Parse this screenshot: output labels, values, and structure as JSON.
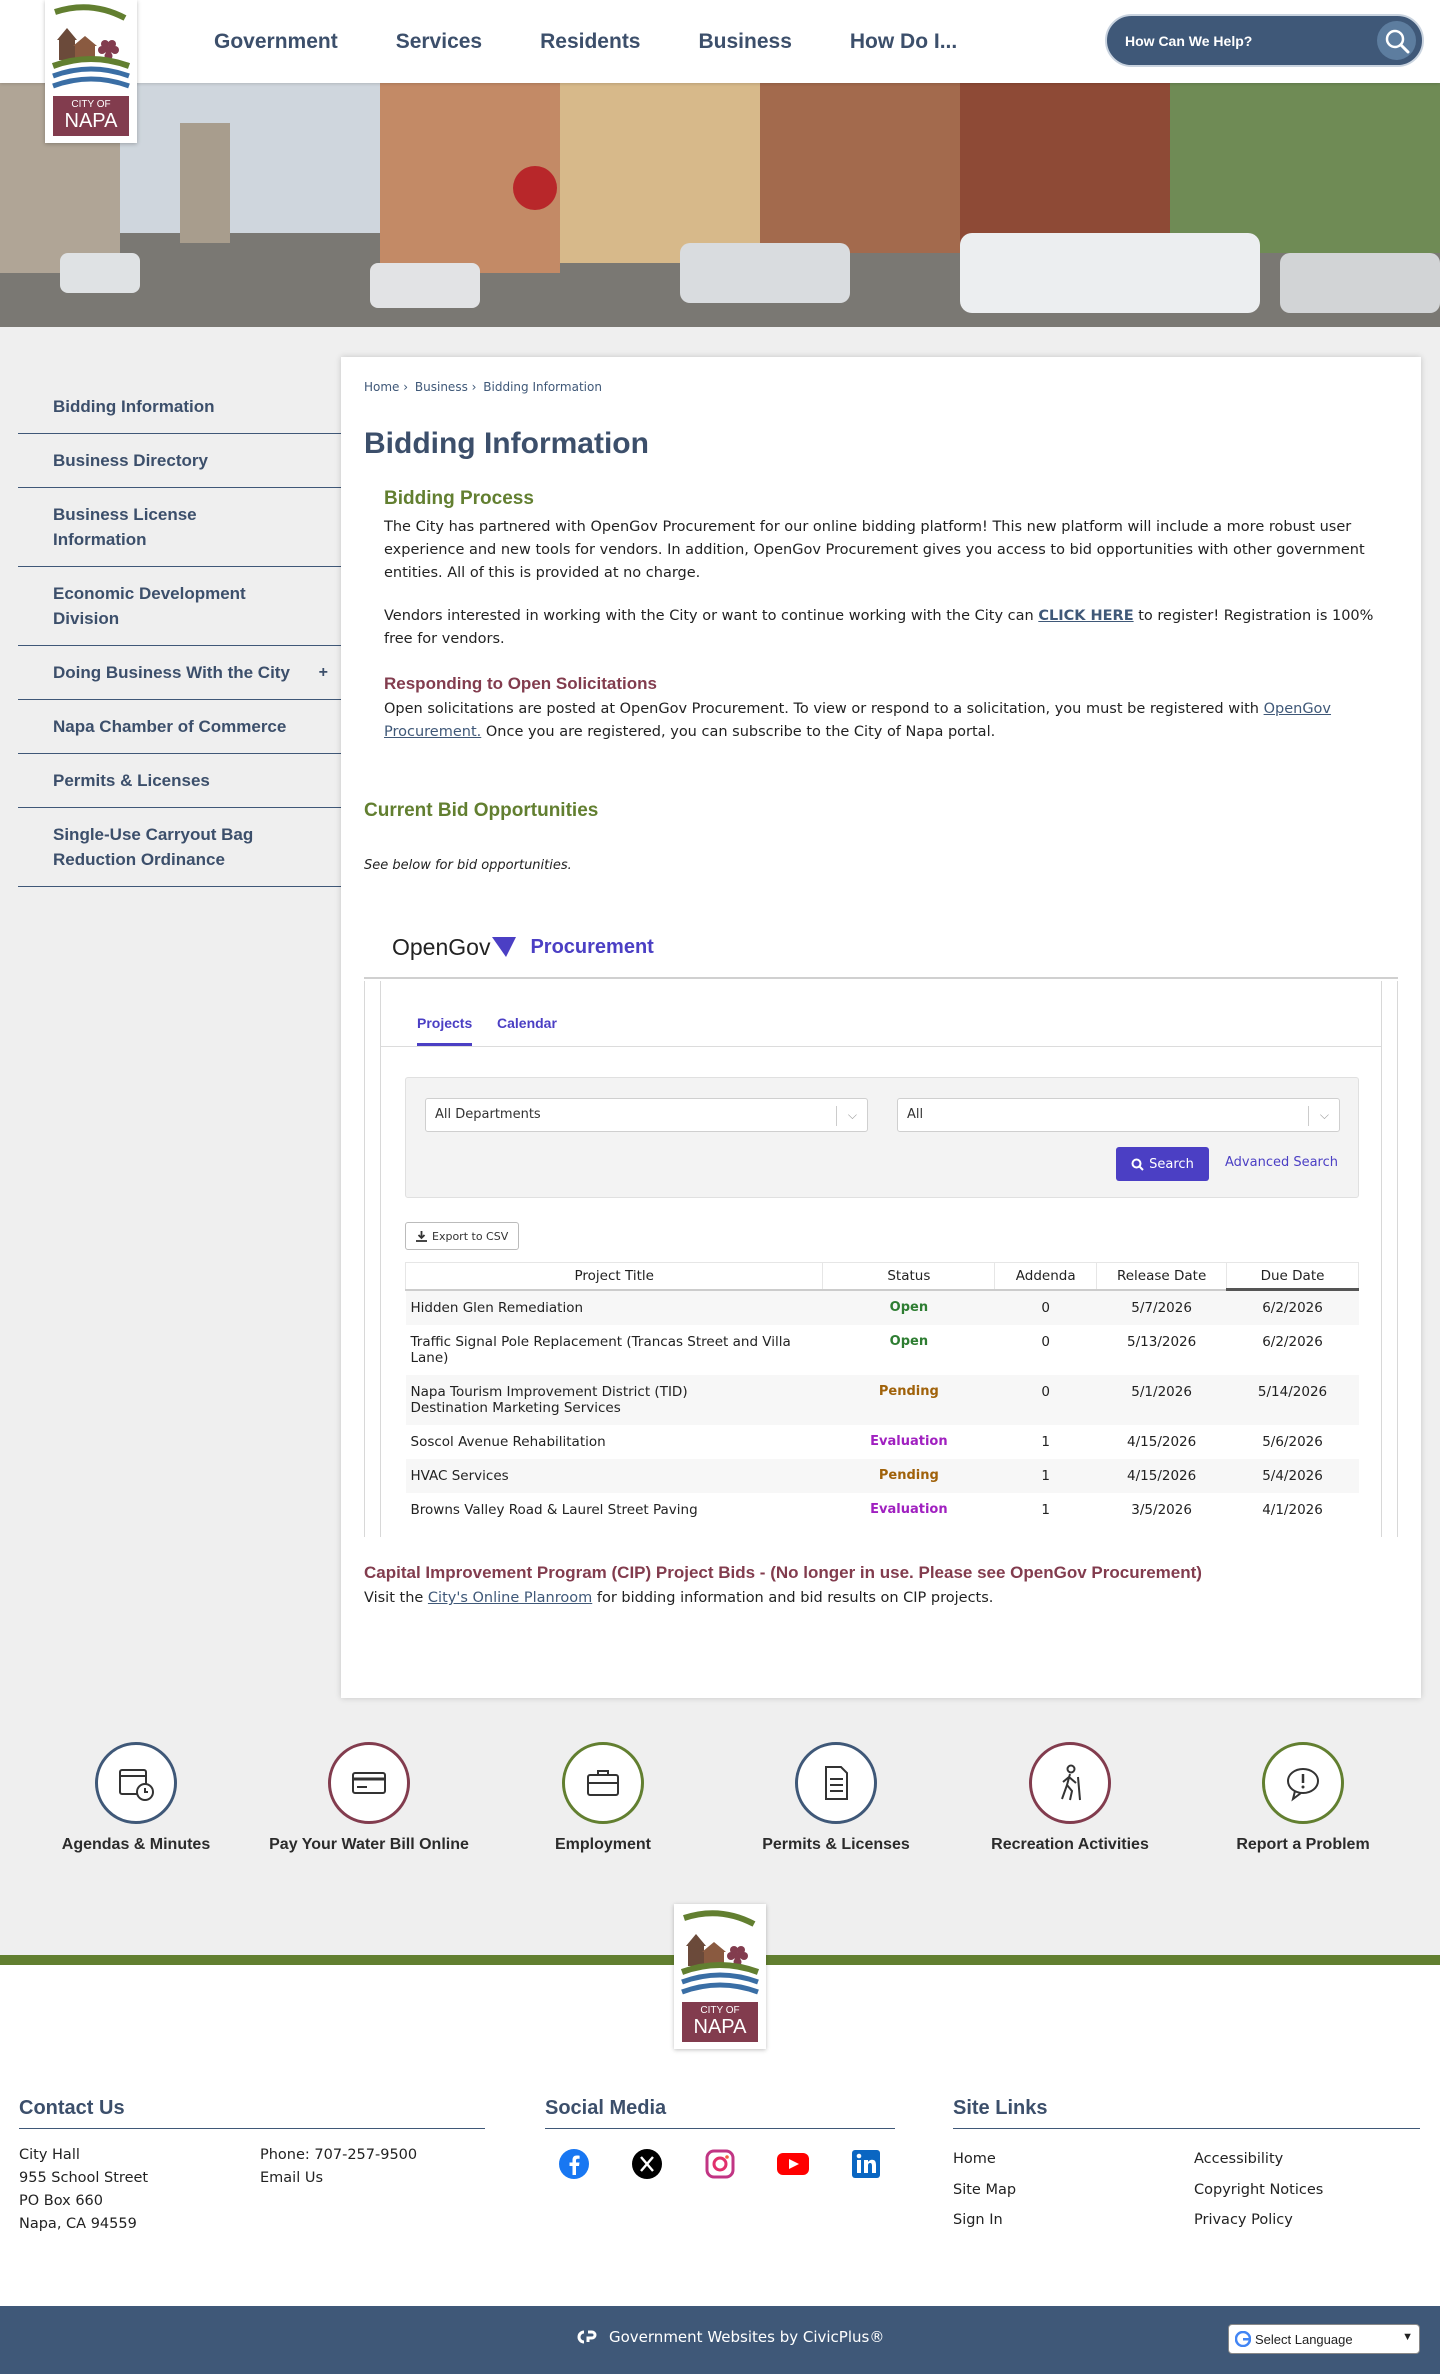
{
  "header": {
    "nav": [
      "Government",
      "Services",
      "Residents",
      "Business",
      "How Do I..."
    ],
    "search_placeholder": "How Can We Help?",
    "logo_text_1": "CITY OF",
    "logo_text_2": "NAPA"
  },
  "sidebar": {
    "items": [
      {
        "label": "Bidding Information"
      },
      {
        "label": "Business Directory"
      },
      {
        "label": "Business License Information"
      },
      {
        "label": "Economic Development Division"
      },
      {
        "label": "Doing Business With the City",
        "expand": "+"
      },
      {
        "label": "Napa Chamber of Commerce"
      },
      {
        "label": "Permits & Licenses"
      },
      {
        "label": "Single-Use Carryout Bag Reduction Ordinance"
      }
    ]
  },
  "breadcrumb": [
    "Home",
    "›",
    "Business",
    "›",
    "Bidding Information"
  ],
  "page_title": "Bidding Information",
  "bidding_process": {
    "heading": "Bidding Process",
    "para1": "The City has partnered with OpenGov Procurement for our online bidding platform! This new platform will include a more robust user experience and new tools for vendors. In addition, OpenGov Procurement gives you access to bid opportunities with other government entities. All of this is provided at no charge.",
    "para2_before": "Vendors interested in working with the City or want to continue working with the City can ",
    "para2_link": "CLICK HERE",
    "para2_after": " to register! Registration is 100% free for vendors."
  },
  "solicitations": {
    "heading": "Responding to Open Solicitations",
    "text_before": "Open solicitations are posted at OpenGov Procurement.  To view or respond to a solicitation, you must be registered with ",
    "link": "OpenGov Procurement.",
    "text_after": " Once you are registered, you can subscribe to the City of Napa portal."
  },
  "current_bids": {
    "heading": "Current Bid Opportunities",
    "note": "See below for bid opportunities."
  },
  "opengov": {
    "brand": "OpenGov",
    "product": "Procurement",
    "tabs": [
      "Projects",
      "Calendar"
    ],
    "department_select": "All Departments",
    "status_select": "All",
    "search_button": "Search",
    "advanced_search": "Advanced Search",
    "export_button": "Export to CSV",
    "columns": [
      "Project Title",
      "Status",
      "Addenda",
      "Release Date",
      "Due Date"
    ],
    "rows": [
      {
        "title": "Hidden Glen Remediation",
        "status": "Open",
        "addenda": "0",
        "release": "5/7/2026",
        "due": "6/2/2026"
      },
      {
        "title": "Traffic Signal Pole Replacement (Trancas Street and Villa Lane)",
        "status": "Open",
        "addenda": "0",
        "release": "5/13/2026",
        "due": "6/2/2026"
      },
      {
        "title": "Napa Tourism Improvement District (TID) Destination Marketing Services",
        "status": "Pending",
        "addenda": "0",
        "release": "5/1/2026",
        "due": "5/14/2026"
      },
      {
        "title": "Soscol Avenue Rehabilitation",
        "status": "Evaluation",
        "addenda": "1",
        "release": "4/15/2026",
        "due": "5/6/2026"
      },
      {
        "title": "HVAC Services",
        "status": "Pending",
        "addenda": "1",
        "release": "4/15/2026",
        "due": "5/4/2026"
      },
      {
        "title": "Browns Valley Road & Laurel Street Paving",
        "status": "Evaluation",
        "addenda": "1",
        "release": "3/5/2026",
        "due": "4/1/2026"
      }
    ]
  },
  "cip": {
    "heading": "Capital Improvement Program (CIP) Project Bids - (No longer in use. Please see OpenGov Procurement)",
    "text_before": "Visit the ",
    "link": "City's Online Planroom",
    "text_after": " for bidding information and bid results on CIP projects."
  },
  "quick_links": [
    {
      "label": "Agendas & Minutes",
      "icon": "calendar-clock-icon",
      "color": "#3f5878"
    },
    {
      "label": "Pay Your Water Bill Online",
      "icon": "credit-card-icon",
      "color": "#823c4e"
    },
    {
      "label": "Employment",
      "icon": "briefcase-icon",
      "color": "#627f30"
    },
    {
      "label": "Permits & Licenses",
      "icon": "document-icon",
      "color": "#3f5878"
    },
    {
      "label": "Recreation Activities",
      "icon": "hiker-icon",
      "color": "#823c4e"
    },
    {
      "label": "Report a Problem",
      "icon": "alert-bubble-icon",
      "color": "#627f30"
    }
  ],
  "footer": {
    "contact_heading": "Contact Us",
    "contact_lines": [
      "City Hall",
      "955 School Street",
      "PO Box 660",
      "Napa, CA 94559"
    ],
    "phone": "Phone: 707-257-9500",
    "email": "Email Us",
    "social_heading": "Social Media",
    "social": [
      "facebook-icon",
      "x-icon",
      "instagram-icon",
      "youtube-icon",
      "linkedin-icon"
    ],
    "sitelinks_heading": "Site Links",
    "sitelinks_col1": [
      "Home",
      "Site Map",
      "Sign In"
    ],
    "sitelinks_col2": [
      "Accessibility",
      "Copyright Notices",
      "Privacy Policy"
    ],
    "civicplus": "Government Websites by CivicPlus®",
    "language": "Select Language"
  },
  "colors": {
    "navy": "#3c4f6b",
    "green": "#627f30",
    "maroon": "#823c4e",
    "opengov_purple": "#4b3fc4",
    "status_open": "#2e7d32",
    "status_pending": "#a0620a",
    "status_evaluation": "#a020c0"
  }
}
